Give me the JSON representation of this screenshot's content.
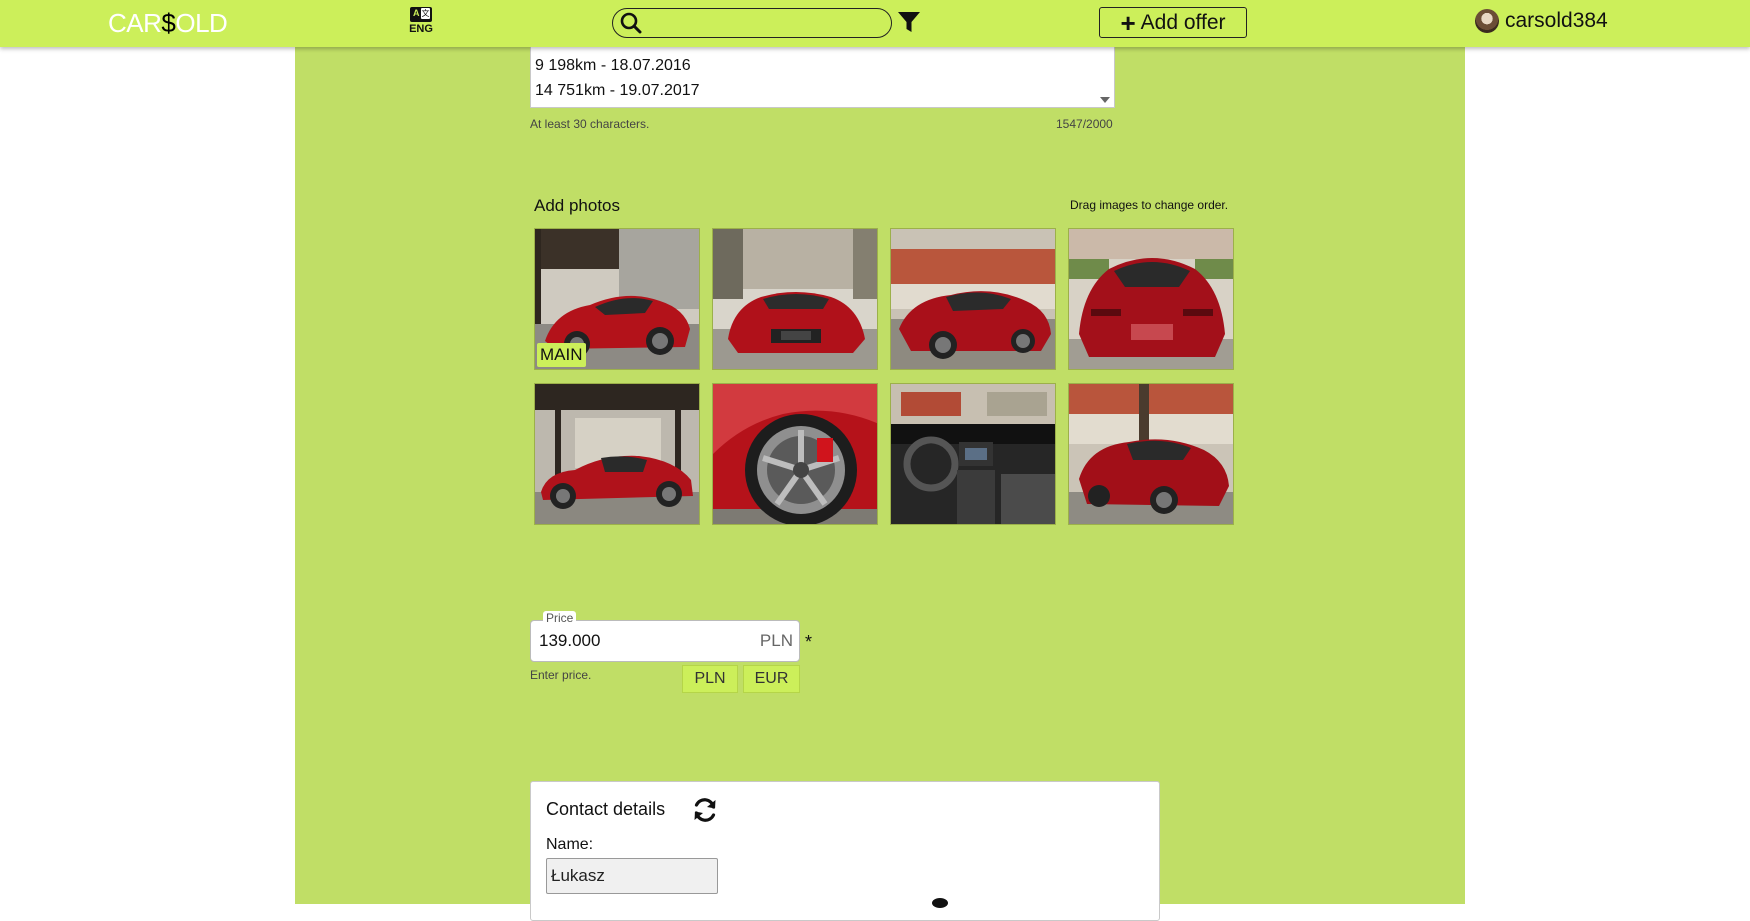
{
  "header": {
    "logo_prefix": "CAR",
    "logo_dollar": "$",
    "logo_suffix": "OLD",
    "lang_label": "ENG",
    "search_placeholder": "",
    "add_offer_label": "Add offer",
    "username": "carsold384"
  },
  "description": {
    "visible_lines": [
      "9 198km - 18.07.2016",
      "14 751km - 19.07.2017"
    ],
    "hint": "At least 30 characters.",
    "counter": "1547/2000"
  },
  "photos": {
    "title": "Add photos",
    "hint": "Drag images to change order.",
    "main_badge": "MAIN",
    "items": [
      {
        "id": "photo-1",
        "view": "front-left three-quarter, under carport"
      },
      {
        "id": "photo-2",
        "view": "front"
      },
      {
        "id": "photo-3",
        "view": "front-right three-quarter"
      },
      {
        "id": "photo-4",
        "view": "rear"
      },
      {
        "id": "photo-5",
        "view": "side profile"
      },
      {
        "id": "photo-6",
        "view": "wheel close-up"
      },
      {
        "id": "photo-7",
        "view": "interior dashboard"
      },
      {
        "id": "photo-8",
        "view": "rear three-quarter"
      }
    ]
  },
  "price": {
    "legend": "Price",
    "value": "139.000",
    "unit": "PLN",
    "required_mark": "*",
    "hint": "Enter price.",
    "currencies": [
      "PLN",
      "EUR"
    ]
  },
  "contact": {
    "title": "Contact details",
    "name_label": "Name:",
    "name_value": "Łukasz"
  },
  "colors": {
    "accent": "#ccef5a",
    "panel": "#c0de66"
  }
}
